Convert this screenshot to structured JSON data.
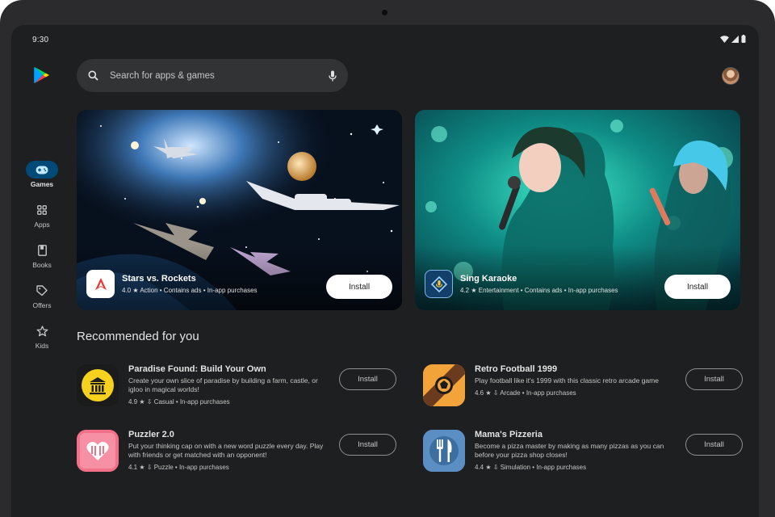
{
  "status": {
    "time": "9:30"
  },
  "search": {
    "placeholder": "Search for apps & games"
  },
  "nav": {
    "items": [
      {
        "label": "Games",
        "icon": "gamepad-icon",
        "active": true
      },
      {
        "label": "Apps",
        "icon": "apps-grid-icon",
        "active": false
      },
      {
        "label": "Books",
        "icon": "book-icon",
        "active": false
      },
      {
        "label": "Offers",
        "icon": "tag-icon",
        "active": false
      },
      {
        "label": "Kids",
        "icon": "star-icon",
        "active": false
      }
    ]
  },
  "featured": [
    {
      "title": "Stars vs. Rockets",
      "rating": "4.0",
      "meta": "Action • Contains ads • In-app purchases",
      "install_label": "Install"
    },
    {
      "title": "Sing Karaoke",
      "rating": "4.2",
      "meta": "Entertainment • Contains ads • In-app purchases",
      "install_label": "Install"
    }
  ],
  "recommended": {
    "title": "Recommended for you",
    "apps": [
      {
        "name": "Paradise Found: Build Your Own",
        "description": "Create your own slice of paradise by building a farm, castle, or igloo in magical worlds!",
        "rating": "4.9",
        "meta": "Casual • In-app purchases",
        "install_label": "Install"
      },
      {
        "name": "Retro Football 1999",
        "description": "Play football like it's 1999 with this classic retro arcade game",
        "rating": "4.6",
        "meta": "Arcade • In-app purchases",
        "install_label": "Install"
      },
      {
        "name": "Puzzler 2.0",
        "description": "Put your thinking cap on with a new word puzzle every day. Play with friends or get matched with an opponent!",
        "rating": "4.1",
        "meta": "Puzzle • In-app purchases",
        "install_label": "Install"
      },
      {
        "name": "Mama's Pizzeria",
        "description": "Become a pizza master by making as many pizzas as you can before your pizza shop closes!",
        "rating": "4.4",
        "meta": "Simulation • In-app purchases",
        "install_label": "Install"
      }
    ]
  },
  "colors": {
    "background": "#1e1f20",
    "rail_active": "#004a77",
    "search_bg": "#323335"
  }
}
